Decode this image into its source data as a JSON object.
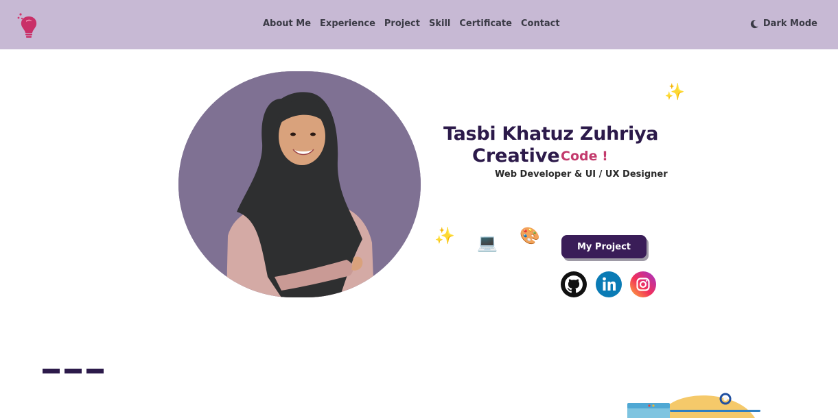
{
  "nav": {
    "links": [
      "About Me",
      "Experience",
      "Project",
      "Skill",
      "Certificate",
      "Contact"
    ],
    "dark_mode_label": "Dark Mode"
  },
  "hero": {
    "name": "Tasbi Khatuz Zuhriya",
    "role_word": "Creative",
    "role_accent": "Code !",
    "subtitle": "Web Developer & UI / UX Designer",
    "cta_label": "My Project",
    "emojis": {
      "sparkle": "✨",
      "laptop": "💻",
      "palette": "🎨"
    },
    "socials": [
      "github-icon",
      "linkedin-icon",
      "instagram-icon"
    ]
  },
  "colors": {
    "navbar_bg": "#c7b9d4",
    "primary": "#2c1a4a",
    "accent": "#c33a6c",
    "button_bg": "#3a1d58",
    "portrait_bg": "#7f7193"
  }
}
